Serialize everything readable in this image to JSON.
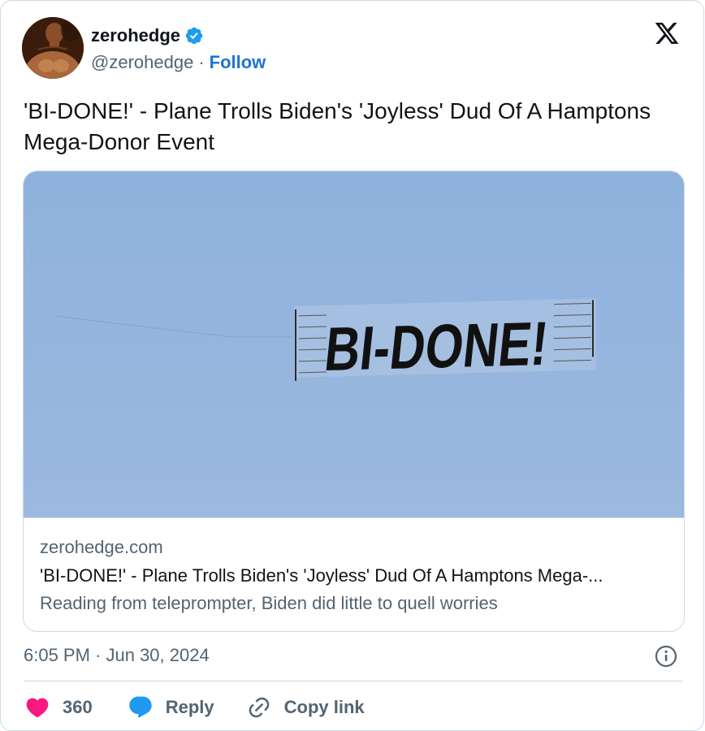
{
  "author": {
    "display_name": "zerohedge",
    "handle": "@zerohedge",
    "separator": "·",
    "follow_label": "Follow",
    "verified_icon": "verified-badge-icon"
  },
  "tweet": {
    "text": "'BI-DONE!' - Plane Trolls Biden's 'Joyless' Dud Of A Hamptons Mega-Donor Event",
    "timestamp": "6:05 PM · Jun 30, 2024"
  },
  "link_card": {
    "image_banner_text": "BI-DONE!",
    "domain": "zerohedge.com",
    "title": "'BI-DONE!' - Plane Trolls Biden's 'Joyless' Dud Of A Hamptons Mega-...",
    "description": "Reading from teleprompter, Biden did little to quell worries"
  },
  "actions": {
    "like_count": "360",
    "reply_label": "Reply",
    "copy_link_label": "Copy link"
  },
  "colors": {
    "like": "#f91880",
    "reply": "#1d9bf0",
    "follow": "#1d74d4",
    "sky": "#93b4de"
  }
}
